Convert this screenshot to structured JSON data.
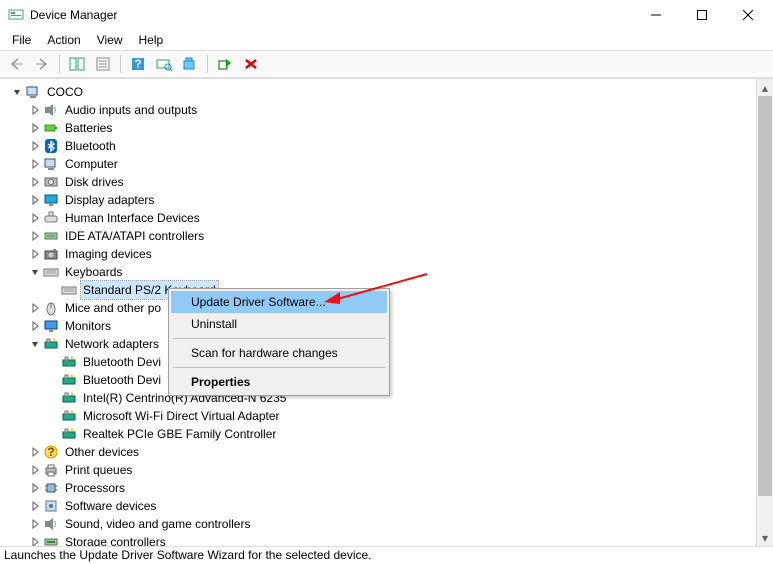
{
  "window": {
    "title": "Device Manager"
  },
  "menu": {
    "file": "File",
    "action": "Action",
    "view": "View",
    "help": "Help"
  },
  "tree": {
    "root": "COCO",
    "items": [
      {
        "label": "Audio inputs and outputs",
        "expand": "closed",
        "icon": "speaker"
      },
      {
        "label": "Batteries",
        "expand": "closed",
        "icon": "battery"
      },
      {
        "label": "Bluetooth",
        "expand": "closed",
        "icon": "bluetooth"
      },
      {
        "label": "Computer",
        "expand": "closed",
        "icon": "pc"
      },
      {
        "label": "Disk drives",
        "expand": "closed",
        "icon": "disk"
      },
      {
        "label": "Display adapters",
        "expand": "closed",
        "icon": "display"
      },
      {
        "label": "Human Interface Devices",
        "expand": "closed",
        "icon": "hid"
      },
      {
        "label": "IDE ATA/ATAPI controllers",
        "expand": "closed",
        "icon": "ide"
      },
      {
        "label": "Imaging devices",
        "expand": "closed",
        "icon": "camera"
      },
      {
        "label": "Keyboards",
        "expand": "open",
        "icon": "keyboard",
        "children": [
          {
            "label": "Standard PS/2 Keyboard",
            "icon": "keyboard",
            "selected": true
          }
        ]
      },
      {
        "label": "Mice and other po",
        "expand": "closed",
        "icon": "mouse"
      },
      {
        "label": "Monitors",
        "expand": "closed",
        "icon": "monitor"
      },
      {
        "label": "Network adapters",
        "expand": "open",
        "icon": "nic",
        "children": [
          {
            "label": "Bluetooth Devi",
            "icon": "nic"
          },
          {
            "label": "Bluetooth Devi",
            "icon": "nic"
          },
          {
            "label": "Intel(R) Centrino(R) Advanced-N 6235",
            "icon": "nic"
          },
          {
            "label": "Microsoft Wi-Fi Direct Virtual Adapter",
            "icon": "nic"
          },
          {
            "label": "Realtek PCIe GBE Family Controller",
            "icon": "nic"
          }
        ]
      },
      {
        "label": "Other devices",
        "expand": "closed",
        "icon": "unknown"
      },
      {
        "label": "Print queues",
        "expand": "closed",
        "icon": "printer"
      },
      {
        "label": "Processors",
        "expand": "closed",
        "icon": "cpu"
      },
      {
        "label": "Software devices",
        "expand": "closed",
        "icon": "soft"
      },
      {
        "label": "Sound, video and game controllers",
        "expand": "closed",
        "icon": "speaker"
      },
      {
        "label": "Storage controllers",
        "expand": "closed",
        "icon": "storage"
      }
    ]
  },
  "context_menu": {
    "items": [
      {
        "label": "Update Driver Software...",
        "highlight": true
      },
      {
        "label": "Uninstall"
      },
      {
        "sep": true
      },
      {
        "label": "Scan for hardware changes"
      },
      {
        "sep": true
      },
      {
        "label": "Properties",
        "bold": true
      }
    ]
  },
  "status": "Launches the Update Driver Software Wizard for the selected device."
}
